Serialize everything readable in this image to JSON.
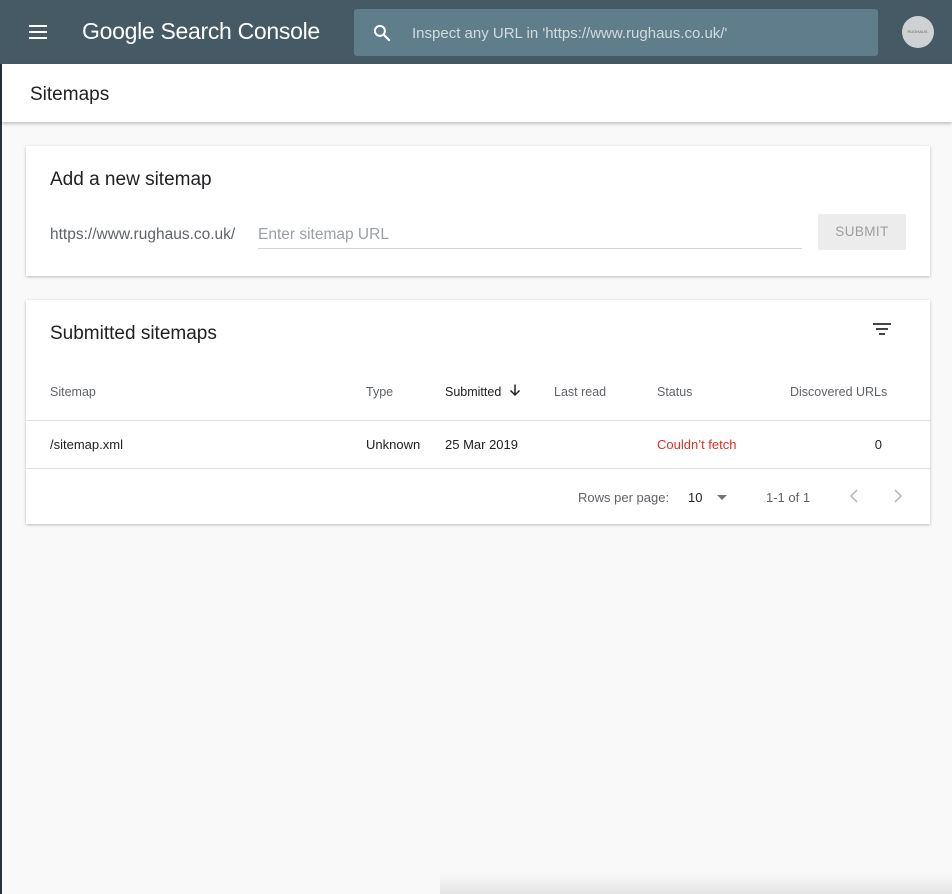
{
  "header": {
    "app_title": "Google Search Console",
    "search_placeholder": "Inspect any URL in 'https://www.rughaus.co.uk/'",
    "avatar_text": "RUGHAUS."
  },
  "page": {
    "title": "Sitemaps"
  },
  "add_sitemap": {
    "title": "Add a new sitemap",
    "url_prefix": "https://www.rughaus.co.uk/",
    "input_placeholder": "Enter sitemap URL",
    "input_value": "",
    "submit_label": "SUBMIT"
  },
  "submitted": {
    "title": "Submitted sitemaps",
    "columns": [
      "Sitemap",
      "Type",
      "Submitted",
      "Last read",
      "Status",
      "Discovered URLs"
    ],
    "sorted_column": "Submitted",
    "sort_direction": "descending",
    "rows": [
      {
        "sitemap": "/sitemap.xml",
        "type": "Unknown",
        "submitted": "25 Mar 2019",
        "last_read": "",
        "status": "Couldn’t fetch",
        "discovered_urls": "0"
      }
    ],
    "pagination": {
      "rows_per_page_label": "Rows per page:",
      "rows_per_page_value": "10",
      "range_label": "1-1 of 1"
    }
  },
  "colors": {
    "header_bg": "#455a64",
    "search_bg": "#607d8b",
    "error": "#d93025"
  },
  "icons": [
    "menu-icon",
    "search-icon",
    "filter-icon",
    "arrow-down-icon",
    "chevron-left-icon",
    "chevron-right-icon",
    "dropdown-caret-icon"
  ]
}
